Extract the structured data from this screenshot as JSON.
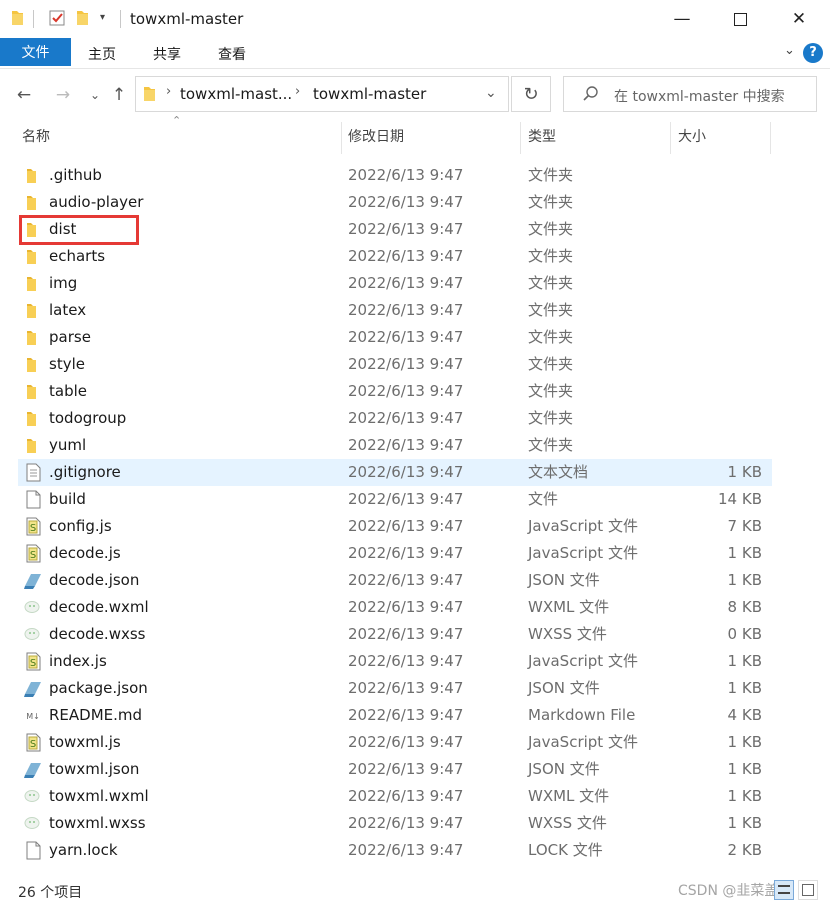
{
  "window": {
    "title": "towxml-master"
  },
  "ribbon": {
    "tabs": [
      "文件",
      "主页",
      "共享",
      "查看"
    ]
  },
  "address": {
    "segments": [
      "towxml-mast...",
      "towxml-master"
    ],
    "search_placeholder": "在 towxml-master 中搜索"
  },
  "columns": {
    "name": "名称",
    "date": "修改日期",
    "type": "类型",
    "size": "大小"
  },
  "files": [
    {
      "name": ".github",
      "date": "2022/6/13 9:47",
      "type": "文件夹",
      "size": "",
      "icon": "folder-icon"
    },
    {
      "name": "audio-player",
      "date": "2022/6/13 9:47",
      "type": "文件夹",
      "size": "",
      "icon": "folder-icon"
    },
    {
      "name": "dist",
      "date": "2022/6/13 9:47",
      "type": "文件夹",
      "size": "",
      "icon": "folder-icon"
    },
    {
      "name": "echarts",
      "date": "2022/6/13 9:47",
      "type": "文件夹",
      "size": "",
      "icon": "folder-icon"
    },
    {
      "name": "img",
      "date": "2022/6/13 9:47",
      "type": "文件夹",
      "size": "",
      "icon": "folder-icon"
    },
    {
      "name": "latex",
      "date": "2022/6/13 9:47",
      "type": "文件夹",
      "size": "",
      "icon": "folder-icon"
    },
    {
      "name": "parse",
      "date": "2022/6/13 9:47",
      "type": "文件夹",
      "size": "",
      "icon": "folder-icon"
    },
    {
      "name": "style",
      "date": "2022/6/13 9:47",
      "type": "文件夹",
      "size": "",
      "icon": "folder-icon"
    },
    {
      "name": "table",
      "date": "2022/6/13 9:47",
      "type": "文件夹",
      "size": "",
      "icon": "folder-icon"
    },
    {
      "name": "todogroup",
      "date": "2022/6/13 9:47",
      "type": "文件夹",
      "size": "",
      "icon": "folder-icon"
    },
    {
      "name": "yuml",
      "date": "2022/6/13 9:47",
      "type": "文件夹",
      "size": "",
      "icon": "folder-icon"
    },
    {
      "name": ".gitignore",
      "date": "2022/6/13 9:47",
      "type": "文本文档",
      "size": "1 KB",
      "icon": "text-file-icon"
    },
    {
      "name": "build",
      "date": "2022/6/13 9:47",
      "type": "文件",
      "size": "14 KB",
      "icon": "blank-file-icon"
    },
    {
      "name": "config.js",
      "date": "2022/6/13 9:47",
      "type": "JavaScript 文件",
      "size": "7 KB",
      "icon": "js-file-icon"
    },
    {
      "name": "decode.js",
      "date": "2022/6/13 9:47",
      "type": "JavaScript 文件",
      "size": "1 KB",
      "icon": "js-file-icon"
    },
    {
      "name": "decode.json",
      "date": "2022/6/13 9:47",
      "type": "JSON 文件",
      "size": "1 KB",
      "icon": "json-file-icon"
    },
    {
      "name": "decode.wxml",
      "date": "2022/6/13 9:47",
      "type": "WXML 文件",
      "size": "8 KB",
      "icon": "wechat-file-icon"
    },
    {
      "name": "decode.wxss",
      "date": "2022/6/13 9:47",
      "type": "WXSS 文件",
      "size": "0 KB",
      "icon": "wechat-file-icon"
    },
    {
      "name": "index.js",
      "date": "2022/6/13 9:47",
      "type": "JavaScript 文件",
      "size": "1 KB",
      "icon": "js-file-icon"
    },
    {
      "name": "package.json",
      "date": "2022/6/13 9:47",
      "type": "JSON 文件",
      "size": "1 KB",
      "icon": "json-file-icon"
    },
    {
      "name": "README.md",
      "date": "2022/6/13 9:47",
      "type": "Markdown File",
      "size": "4 KB",
      "icon": "markdown-file-icon"
    },
    {
      "name": "towxml.js",
      "date": "2022/6/13 9:47",
      "type": "JavaScript 文件",
      "size": "1 KB",
      "icon": "js-file-icon"
    },
    {
      "name": "towxml.json",
      "date": "2022/6/13 9:47",
      "type": "JSON 文件",
      "size": "1 KB",
      "icon": "json-file-icon"
    },
    {
      "name": "towxml.wxml",
      "date": "2022/6/13 9:47",
      "type": "WXML 文件",
      "size": "1 KB",
      "icon": "wechat-file-icon"
    },
    {
      "name": "towxml.wxss",
      "date": "2022/6/13 9:47",
      "type": "WXSS 文件",
      "size": "1 KB",
      "icon": "wechat-file-icon"
    },
    {
      "name": "yarn.lock",
      "date": "2022/6/13 9:47",
      "type": "LOCK 文件",
      "size": "2 KB",
      "icon": "blank-file-icon"
    }
  ],
  "selected_file": ".gitignore",
  "highlighted_file": "dist",
  "status": {
    "count": "26 个项目"
  },
  "watermark": "CSDN @韭菜盖饭",
  "colors": {
    "accent": "#1979ca",
    "selection": "#e5f3ff",
    "highlight_box": "#e53935",
    "folder": "#f5c542"
  }
}
